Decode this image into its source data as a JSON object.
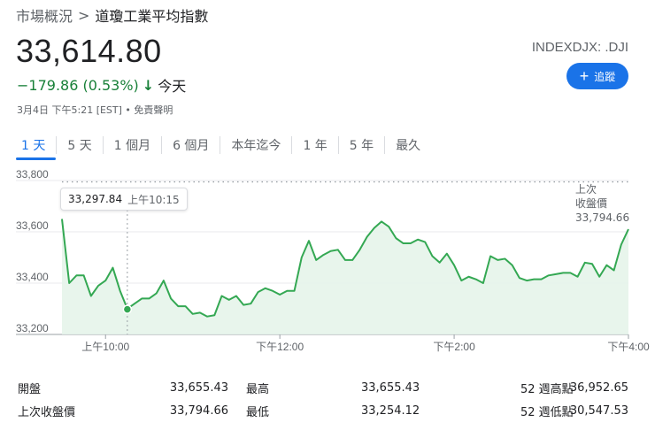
{
  "breadcrumb": {
    "parent": "市場概況",
    "separator": ">",
    "current": "道瓊工業平均指數"
  },
  "quote": {
    "price": "33,614.80",
    "change": "−179.86 (0.53%)",
    "arrow": "↓",
    "period": "今天",
    "ticker": "INDEXDJX: .DJI",
    "timestamp": "3月4日 下午5:21 [EST] • 免責聲明"
  },
  "follow_button": {
    "label": "追蹤"
  },
  "tabs": [
    {
      "label": "1 天",
      "active": true
    },
    {
      "label": "5 天"
    },
    {
      "label": "1 個月"
    },
    {
      "label": "6 個月"
    },
    {
      "label": "本年迄今"
    },
    {
      "label": "1 年"
    },
    {
      "label": "5 年"
    },
    {
      "label": "最久"
    }
  ],
  "tooltip": {
    "value": "33,297.84",
    "time": "上午10:15"
  },
  "previous_close": {
    "label_line1": "上次",
    "label_line2": "收盤價",
    "value": "33,794.66"
  },
  "colors": {
    "line": "#34a853",
    "fill": "#e6f4ea",
    "accent": "#1a73e8",
    "negative": "#188038"
  },
  "chart_data": {
    "type": "area",
    "y_ticks": [
      "33,800",
      "33,600",
      "33,400",
      "33,200"
    ],
    "ylim": [
      33200,
      33800
    ],
    "x_ticks": [
      {
        "label": "上午10:00",
        "t": 30
      },
      {
        "label": "下午12:00",
        "t": 150
      },
      {
        "label": "下午2:00",
        "t": 270
      },
      {
        "label": "下午4:00",
        "t": 390
      }
    ],
    "xlim": [
      0,
      390
    ],
    "previous_close": 33794.66,
    "highlight": {
      "t": 45,
      "v": 33297.84
    },
    "t": [
      0,
      5,
      10,
      15,
      20,
      25,
      30,
      35,
      40,
      45,
      50,
      55,
      60,
      65,
      70,
      75,
      80,
      85,
      90,
      95,
      100,
      105,
      110,
      115,
      120,
      125,
      130,
      135,
      140,
      145,
      150,
      155,
      160,
      165,
      170,
      175,
      180,
      185,
      190,
      195,
      200,
      205,
      210,
      215,
      220,
      225,
      230,
      235,
      240,
      245,
      250,
      255,
      260,
      265,
      270,
      275,
      280,
      285,
      290,
      295,
      300,
      305,
      310,
      315,
      320,
      325,
      330,
      335,
      340,
      345,
      350,
      355,
      360,
      365,
      370,
      375,
      380,
      385,
      390
    ],
    "values": [
      33650,
      33400,
      33430,
      33430,
      33350,
      33390,
      33410,
      33460,
      33370,
      33300,
      33320,
      33340,
      33340,
      33360,
      33410,
      33340,
      33310,
      33310,
      33280,
      33285,
      33270,
      33275,
      33350,
      33335,
      33350,
      33315,
      33320,
      33365,
      33380,
      33370,
      33355,
      33370,
      33370,
      33500,
      33565,
      33490,
      33510,
      33525,
      33530,
      33490,
      33490,
      33530,
      33580,
      33615,
      33640,
      33620,
      33575,
      33555,
      33555,
      33570,
      33560,
      33505,
      33480,
      33515,
      33470,
      33410,
      33425,
      33415,
      33400,
      33505,
      33490,
      33495,
      33470,
      33420,
      33410,
      33415,
      33415,
      33430,
      33435,
      33440,
      33440,
      33425,
      33480,
      33475,
      33425,
      33470,
      33450,
      33550,
      33610
    ]
  },
  "stats": [
    {
      "label1": "開盤",
      "value1": "33,655.43",
      "label2": "最高",
      "value2": "33,655.43",
      "label3": "52 週高點",
      "value3": "36,952.65"
    },
    {
      "label1": "上次收盤價",
      "value1": "33,794.66",
      "label2": "最低",
      "value2": "33,254.12",
      "label3": "52 週低點",
      "value3": "30,547.53"
    }
  ]
}
